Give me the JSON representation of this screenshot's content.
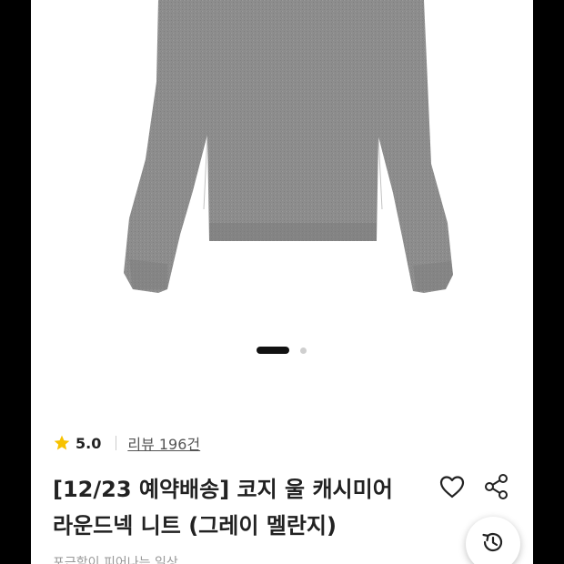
{
  "product": {
    "rating": "5.0",
    "review_link": "리뷰 196건",
    "title_line1": "[12/23 예약배송] 코지 울 캐시미어",
    "title_line2": "라운드넥 니트 (그레이 멜란지)",
    "subline": "포근함이 피어나는 일상"
  },
  "carousel": {
    "total_slides": 2,
    "current_slide": 1
  },
  "icons": {
    "rating": "star-icon",
    "wishlist": "heart-icon",
    "share": "share-icon",
    "recent": "history-icon"
  },
  "colors": {
    "star": "#f7c200",
    "text": "#222222",
    "background": "#ffffff"
  }
}
